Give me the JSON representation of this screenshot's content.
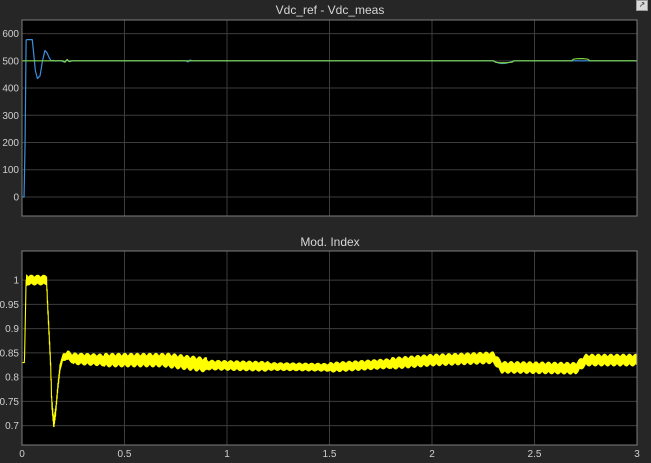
{
  "window": {
    "corner_icon": "restore-arrow-icon"
  },
  "colors": {
    "background": "#262626",
    "plot_area": "#000000",
    "axes": "#7d7d7d",
    "grid": "#3d3d3d",
    "text": "#d6d6d6",
    "series_blue": "#3d8fe0",
    "series_yellow": "#ffff00",
    "series_green": "#7fd645"
  },
  "chart_data": [
    {
      "type": "line",
      "title": "Vdc_ref - Vdc_meas",
      "xlim": [
        0,
        3
      ],
      "ylim": [
        -70,
        650
      ],
      "xticks": [
        0,
        0.5,
        1,
        1.5,
        2,
        2.5,
        3
      ],
      "yticks": [
        0,
        100,
        200,
        300,
        400,
        500,
        600
      ],
      "ytick_labels": [
        "0",
        "100",
        "200",
        "300",
        "400",
        "500",
        "600"
      ],
      "grid": true,
      "series": [
        {
          "color": "#3d8fe0",
          "x": [
            0,
            0.01,
            0.015,
            0.018,
            0.02,
            0.023,
            0.05,
            0.058,
            0.065,
            0.075,
            0.088,
            0.1,
            0.112,
            0.122,
            0.132,
            0.142,
            0.152,
            0.162,
            0.175,
            0.19,
            0.205,
            0.22,
            0.235,
            0.25,
            0.8,
            0.81,
            0.82,
            0.83,
            2.3,
            2.32,
            2.34,
            2.36,
            2.38,
            2.4,
            3.0
          ],
          "y": [
            0,
            0,
            200,
            420,
            575,
            578,
            578,
            520,
            465,
            435,
            445,
            500,
            538,
            530,
            512,
            500,
            502,
            499,
            501,
            500,
            496,
            503,
            498,
            500,
            500,
            496,
            503,
            500,
            500,
            493,
            490,
            491,
            495,
            500,
            500
          ]
        },
        {
          "color": "#7fd645",
          "x": [
            0,
            0.2,
            0.21,
            0.22,
            0.23,
            0.24,
            2.3,
            2.31,
            2.33,
            2.36,
            2.39,
            2.4,
            2.68,
            2.69,
            2.71,
            2.74,
            2.76,
            2.77,
            3.0
          ],
          "y": [
            500,
            500,
            495,
            505,
            497,
            500,
            500,
            495,
            493,
            493,
            495,
            500,
            500,
            506,
            508,
            508,
            506,
            500,
            500
          ]
        }
      ]
    },
    {
      "type": "line",
      "title": "Mod. Index",
      "xlim": [
        0,
        3
      ],
      "ylim": [
        0.66,
        1.06
      ],
      "xticks": [
        0,
        0.5,
        1,
        1.5,
        2,
        2.5,
        3
      ],
      "xtick_labels": [
        "0",
        "0.5",
        "1",
        "1.5",
        "2",
        "2.5",
        "3"
      ],
      "yticks": [
        0.7,
        0.75,
        0.8,
        0.85,
        0.9,
        0.95,
        1
      ],
      "ytick_labels": [
        "0.7",
        "0.75",
        "0.8",
        "0.85",
        "0.9",
        "0.95",
        "1"
      ],
      "grid": true,
      "series": [
        {
          "color": "#ffff00",
          "ripple": [
            0.0,
            0.0,
            0.012,
            0.01,
            0.01,
            0.01,
            0.01,
            0.012,
            0.012,
            0.011,
            0.008,
            0.008,
            0.007,
            0.008,
            0.01,
            0.012,
            0.014,
            0.015,
            0.01,
            0.008,
            0.01,
            0.012,
            0.012
          ],
          "x": [
            0,
            0.012,
            0.02,
            0.025,
            0.03,
            0.12,
            0.125,
            0.14,
            0.145,
            0.155,
            0.165,
            0.175,
            0.185,
            0.2,
            0.22,
            0.25,
            0.4,
            0.7,
            0.9,
            1.2,
            1.5,
            1.8,
            2.0,
            2.3,
            2.34,
            2.4,
            2.7,
            2.75,
            3.0
          ],
          "y": [
            0.83,
            0.83,
            1.0,
            1.0,
            1.0,
            1.0,
            0.95,
            0.82,
            0.75,
            0.705,
            0.73,
            0.78,
            0.82,
            0.84,
            0.845,
            0.838,
            0.835,
            0.835,
            0.825,
            0.822,
            0.82,
            0.828,
            0.835,
            0.84,
            0.82,
            0.82,
            0.818,
            0.835,
            0.835
          ]
        }
      ]
    }
  ]
}
